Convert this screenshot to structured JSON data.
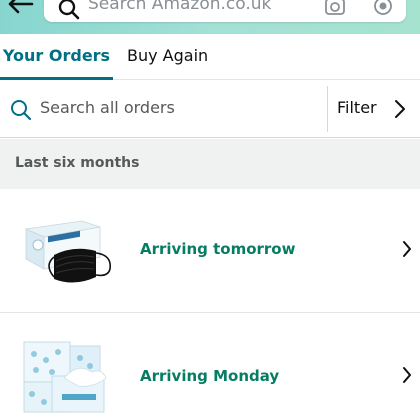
{
  "header": {
    "search_placeholder": "Search Amazon.co.uk",
    "icons": [
      "back-arrow-icon",
      "search-icon",
      "camera-icon",
      "voice-icon"
    ]
  },
  "tabs": [
    {
      "label": "Your Orders",
      "active": true
    },
    {
      "label": "Buy Again",
      "active": false
    }
  ],
  "order_search": {
    "placeholder": "Search all orders",
    "filter_label": "Filter"
  },
  "section": {
    "title": "Last six months"
  },
  "orders": [
    {
      "status": "Arriving tomorrow",
      "thumbnail": "surgical-face-masks"
    },
    {
      "status": "Arriving Monday",
      "thumbnail": "facial-tissues"
    }
  ],
  "colors": {
    "accent": "#007185",
    "status_green": "#067d62",
    "section_bg": "#f0f2f2",
    "header_gradient_start": "#86d6cf",
    "header_gradient_end": "#a5e3cf"
  }
}
